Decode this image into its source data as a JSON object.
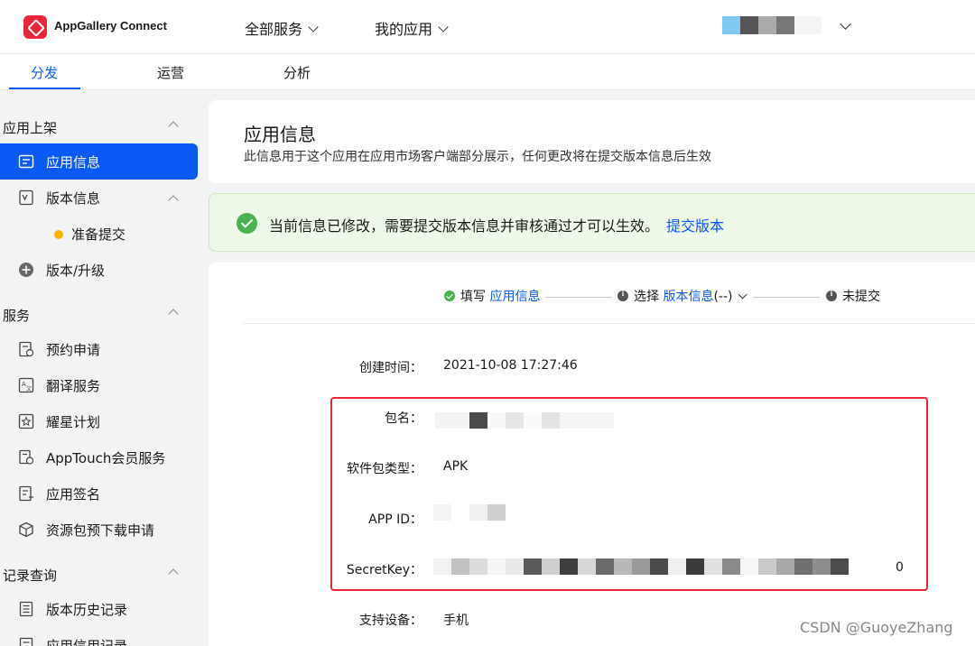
{
  "header": {
    "brand": "AppGallery Connect",
    "nav": [
      {
        "label": "全部服务"
      },
      {
        "label": "我的应用"
      }
    ]
  },
  "tabs": [
    {
      "label": "分发",
      "active": true
    },
    {
      "label": "运营",
      "active": false
    },
    {
      "label": "分析",
      "active": false
    }
  ],
  "sidebar": {
    "sections": [
      {
        "title": "应用上架",
        "items": [
          {
            "label": "应用信息",
            "icon": "app-info-icon",
            "active": true
          },
          {
            "label": "版本信息",
            "icon": "version-info-icon"
          },
          {
            "label": "准备提交",
            "status": "dot-yellow"
          },
          {
            "label": "版本/升级",
            "icon": "plus-circle-icon"
          }
        ]
      },
      {
        "title": "服务",
        "items": [
          {
            "label": "预约申请",
            "icon": "reservation-icon"
          },
          {
            "label": "翻译服务",
            "icon": "translate-icon"
          },
          {
            "label": "耀星计划",
            "icon": "star-plan-icon"
          },
          {
            "label": "AppTouch会员服务",
            "icon": "apptouch-icon"
          },
          {
            "label": "应用签名",
            "icon": "signature-icon"
          },
          {
            "label": "资源包预下载申请",
            "icon": "resource-package-icon"
          }
        ]
      },
      {
        "title": "记录查询",
        "items": [
          {
            "label": "版本历史记录",
            "icon": "history-icon"
          },
          {
            "label": "应用信用记录",
            "icon": "credit-record-icon"
          }
        ]
      }
    ]
  },
  "main": {
    "title": "应用信息",
    "desc": "此信息用于这个应用在应用市场客户端部分展示，任何更改将在提交版本信息后生效",
    "alert": {
      "message": "当前信息已修改，需要提交版本信息并审核通过才可以生效。",
      "link": "提交版本"
    },
    "steps": {
      "step1_prefix": "填写",
      "step1_link": "应用信息",
      "step2_prefix": "选择",
      "step2_link": "版本信息",
      "step2_suffix": "(--)",
      "step3": "未提交"
    },
    "fields": {
      "created_label": "创建时间：",
      "created_value": "2021-10-08 17:27:46",
      "package_label": "包名：",
      "type_label": "软件包类型：",
      "type_value": "APK",
      "appid_label": "APP ID：",
      "secret_label": "SecretKey：",
      "secret_tail": "0",
      "device_label": "支持设备：",
      "device_value": "手机"
    }
  },
  "watermark": "CSDN @GuoyeZhang",
  "colors": {
    "accent": "#0a59f7",
    "success": "#4ab050",
    "highlight": "#e8283a",
    "pending": "#f7b500"
  }
}
